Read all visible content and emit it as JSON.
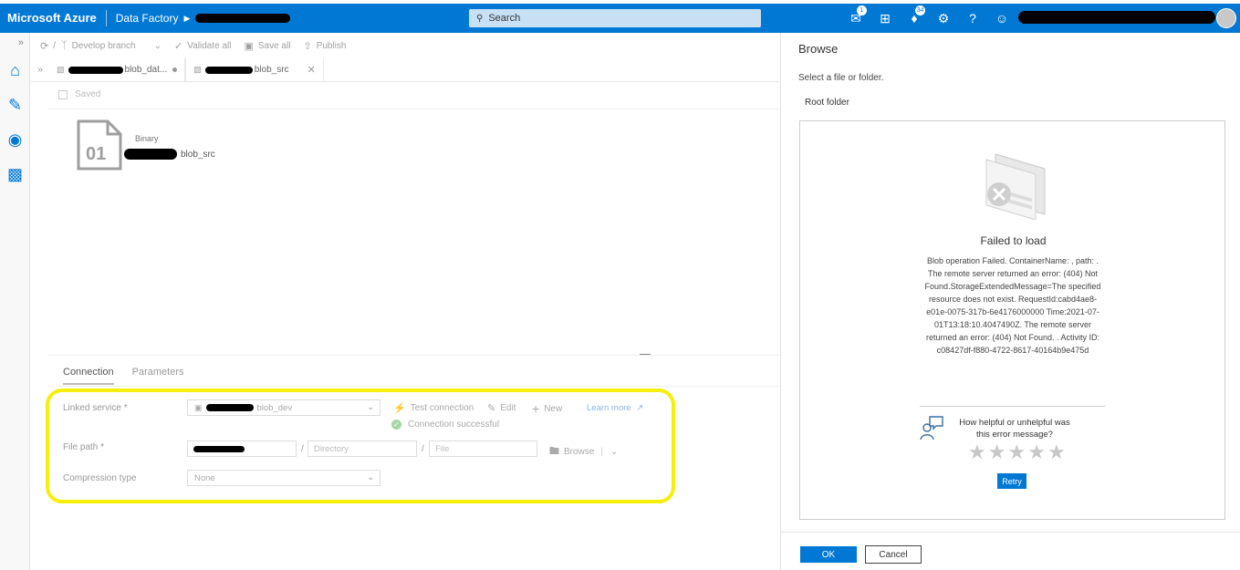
{
  "header": {
    "brand": "Microsoft Azure",
    "product": "Data Factory",
    "search_placeholder": "Search",
    "notifications_badge": "1",
    "alerts_badge": "34",
    "colors": {
      "bar": "#0078d4",
      "search": "#c7e0f4"
    }
  },
  "toolbar": {
    "branch": "Develop branch",
    "validate_all": "Validate all",
    "save_all": "Save all",
    "publish": "Publish"
  },
  "tabs": [
    {
      "label": "blob_dat..."
    },
    {
      "label": "blob_src"
    }
  ],
  "editor": {
    "saved_label": "Saved",
    "dataset_type": "Binary",
    "dataset_name": "blob_src",
    "dataset_icon_text": "01"
  },
  "bottom": {
    "tabs": [
      "Connection",
      "Parameters"
    ],
    "linked_service_label": "Linked service *",
    "linked_service_value": "blob_dev",
    "test_connection": "Test connection",
    "edit": "Edit",
    "new": "New",
    "learn_more": "Learn more",
    "connection_status": "Connection successful",
    "file_path_label": "File path *",
    "directory_placeholder": "Directory",
    "file_placeholder": "File",
    "browse": "Browse",
    "compression_label": "Compression type",
    "compression_value": "None",
    "highlight_color": "#f5ef0b"
  },
  "panel": {
    "title": "Browse",
    "subtitle": "Select a file or folder.",
    "root_folder": "Root folder",
    "error_title": "Failed to load",
    "error_message": "Blob operation Failed. ContainerName: , path: . The remote server returned an error: (404) Not Found.StorageExtendedMessage=The specified resource does not exist. RequestId:cabd4ae8-e01e-0075-317b-6e4176000000 Time:2021-07-01T13:18:10.4047490Z. The remote server returned an error: (404) Not Found. . Activity ID: c08427df-f880-4722-8617-40164b9e475d",
    "feedback_question": "How helpful or unhelpful was this error message?",
    "rating": 0,
    "retry": "Retry",
    "ok": "OK",
    "cancel": "Cancel"
  }
}
